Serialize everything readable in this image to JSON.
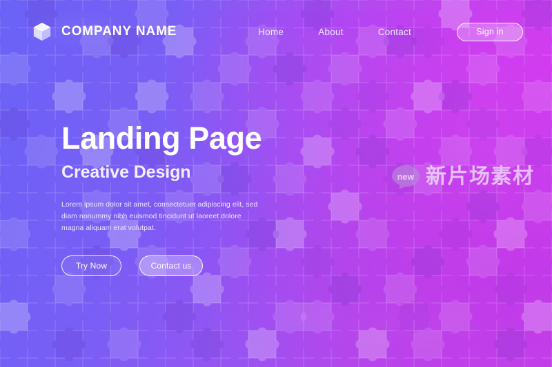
{
  "header": {
    "logo_icon": "cube-icon",
    "brand_name": "COMPANY NAME",
    "nav": [
      {
        "label": "Home"
      },
      {
        "label": "About"
      },
      {
        "label": "Contact"
      }
    ],
    "signin_label": "Sign in"
  },
  "hero": {
    "title": "Landing Page",
    "subtitle": "Creative Design",
    "paragraph": "Lorem ipsum dolor sit amet, consectetuer adipiscing elit, sed diam nonummy nibh euismod tincidunt ut laoreet dolore magna aliquam erat volutpat.",
    "primary_button": "Try Now",
    "secondary_button": "Contact us"
  },
  "watermark": {
    "badge_label": "new",
    "text": "新片场素材"
  },
  "theme": {
    "gradient_start": "#6a62f6",
    "gradient_mid": "#9a53f2",
    "gradient_end": "#c441e9",
    "accent_magenta": "#d23cf0",
    "text_on_dark": "#ffffff",
    "background_pattern": "jigsaw-puzzle"
  }
}
